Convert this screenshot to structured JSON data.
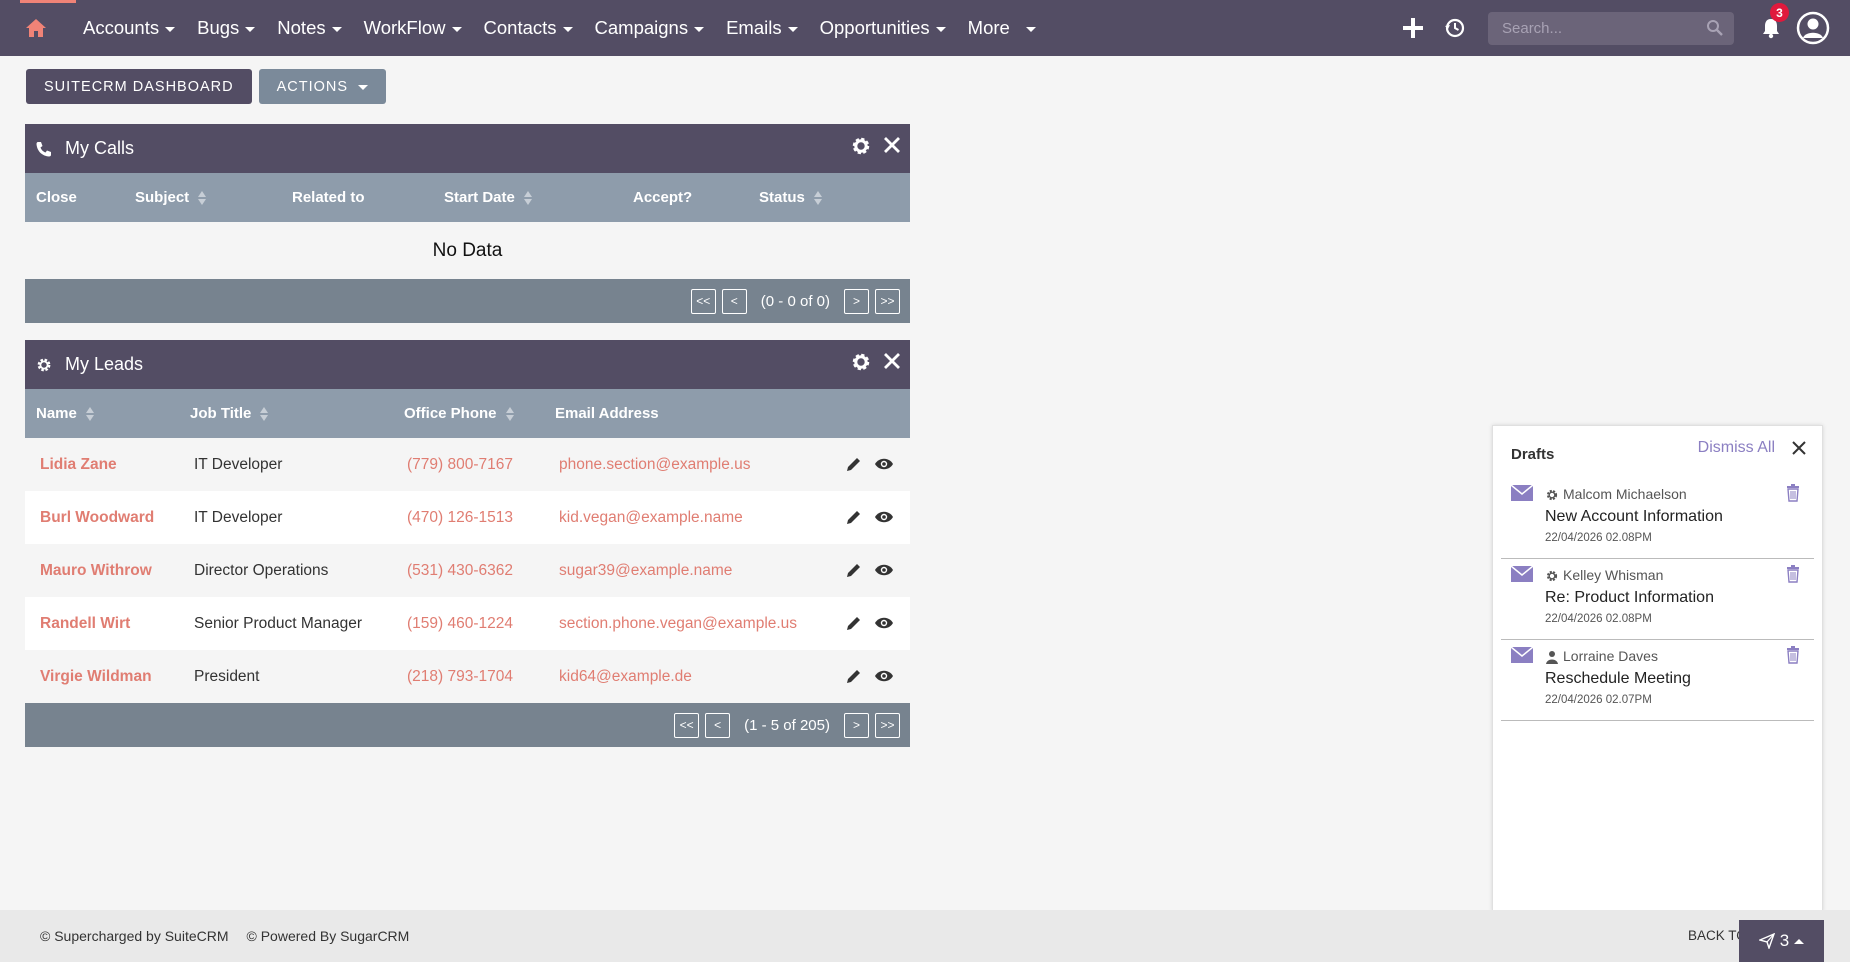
{
  "nav": {
    "items": [
      {
        "label": "Accounts"
      },
      {
        "label": "Bugs"
      },
      {
        "label": "Notes"
      },
      {
        "label": "WorkFlow"
      },
      {
        "label": "Contacts"
      },
      {
        "label": "Campaigns"
      },
      {
        "label": "Emails"
      },
      {
        "label": "Opportunities"
      },
      {
        "label": "More"
      }
    ],
    "search_placeholder": "Search...",
    "notification_count": "3",
    "colors": {
      "bar": "#534d64",
      "accent": "#f08377",
      "badge": "#e0193d"
    },
    "icons": [
      "home-icon",
      "plus-icon",
      "history-icon",
      "search-icon",
      "bell-icon",
      "user-avatar-icon"
    ]
  },
  "toolbar": {
    "dashboard_label": "SUITECRM DASHBOARD",
    "actions_label": "ACTIONS"
  },
  "calls": {
    "title": "My Calls",
    "headers": {
      "close": "Close",
      "subject": "Subject",
      "related": "Related to",
      "start": "Start Date",
      "accept": "Accept?",
      "status": "Status"
    },
    "empty": "No Data",
    "pager": {
      "first": "<<",
      "prev": "<",
      "info": "(0 - 0 of 0)",
      "next": ">",
      "last": ">>"
    }
  },
  "leads": {
    "title": "My Leads",
    "headers": {
      "name": "Name",
      "job": "Job Title",
      "phone": "Office Phone",
      "email": "Email Address"
    },
    "rows": [
      {
        "name": "Lidia Zane",
        "job": "IT Developer",
        "phone": "(779) 800-7167",
        "email": "phone.section@example.us"
      },
      {
        "name": "Burl Woodward",
        "job": "IT Developer",
        "phone": "(470) 126-1513",
        "email": "kid.vegan@example.name"
      },
      {
        "name": "Mauro Withrow",
        "job": "Director Operations",
        "phone": "(531) 430-6362",
        "email": "sugar39@example.name"
      },
      {
        "name": "Randell Wirt",
        "job": "Senior Product Manager",
        "phone": "(159) 460-1224",
        "email": "section.phone.vegan@example.us"
      },
      {
        "name": "Virgie Wildman",
        "job": "President",
        "phone": "(218) 793-1704",
        "email": "kid64@example.de"
      }
    ],
    "pager": {
      "first": "<<",
      "prev": "<",
      "info": "(1 - 5 of 205)",
      "next": ">",
      "last": ">>"
    }
  },
  "drafts": {
    "title": "Drafts",
    "dismiss_all": "Dismiss All",
    "items": [
      {
        "who": "Malcom Michaelson",
        "who_icon": "gear-icon",
        "subject": "New Account Information",
        "date": "22/04/2026 02.08PM"
      },
      {
        "who": "Kelley Whisman",
        "who_icon": "gear-icon",
        "subject": "Re: Product Information",
        "date": "22/04/2026 02.08PM"
      },
      {
        "who": "Lorraine Daves",
        "who_icon": "person-icon",
        "subject": "Reschedule Meeting",
        "date": "22/04/2026 02.07PM"
      }
    ]
  },
  "footer": {
    "supercharged": "© Supercharged by SuiteCRM",
    "powered": "© Powered By SugarCRM",
    "back_to_top": "BACK TO TOP",
    "send_count": "3"
  }
}
